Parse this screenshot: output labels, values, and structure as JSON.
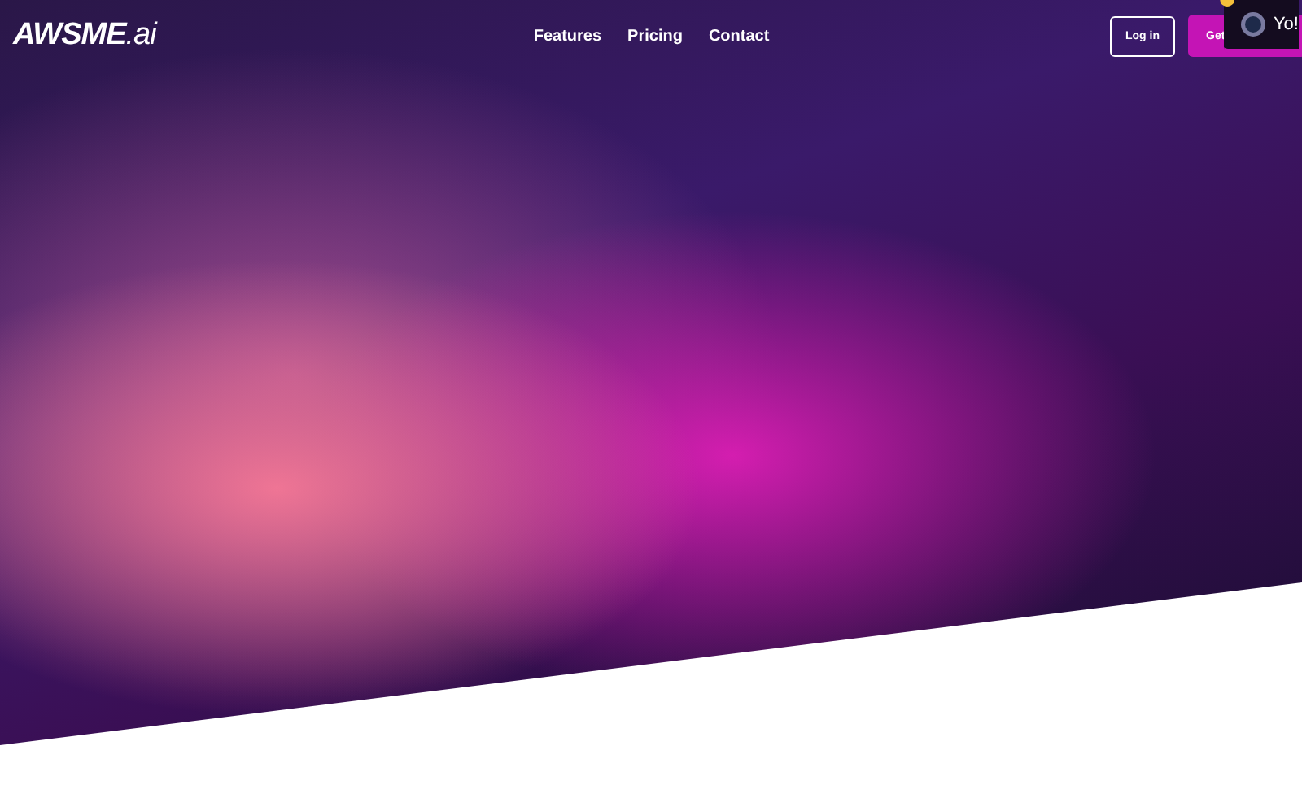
{
  "logo": {
    "main": "AWSME",
    "suffix": ".ai"
  },
  "nav_links": [
    "Features",
    "Pricing",
    "Contact"
  ],
  "login_button": "Log in",
  "cta_button": "Get",
  "chat_popup": {
    "message": "Yo!"
  }
}
